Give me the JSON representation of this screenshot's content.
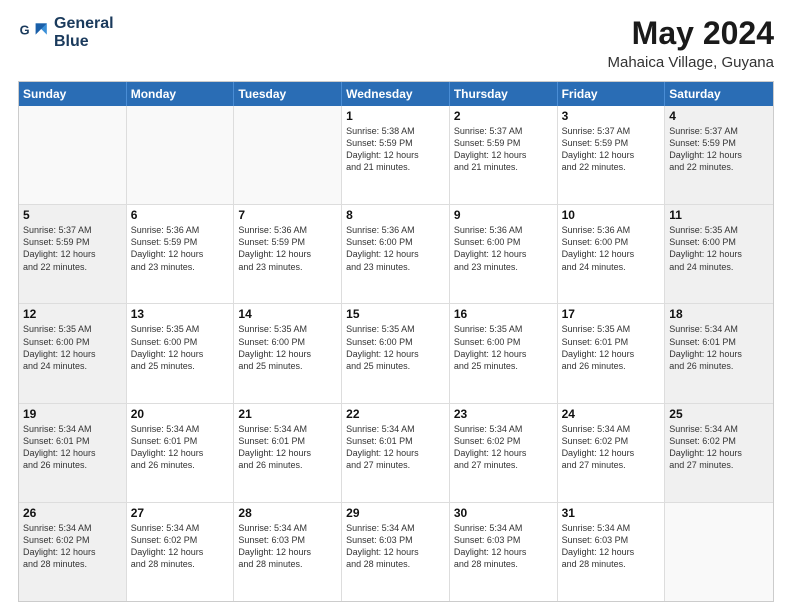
{
  "header": {
    "logo_line1": "General",
    "logo_line2": "Blue",
    "month_title": "May 2024",
    "location": "Mahaica Village, Guyana"
  },
  "days_of_week": [
    "Sunday",
    "Monday",
    "Tuesday",
    "Wednesday",
    "Thursday",
    "Friday",
    "Saturday"
  ],
  "weeks": [
    [
      {
        "day": "",
        "info": ""
      },
      {
        "day": "",
        "info": ""
      },
      {
        "day": "",
        "info": ""
      },
      {
        "day": "1",
        "info": "Sunrise: 5:38 AM\nSunset: 5:59 PM\nDaylight: 12 hours\nand 21 minutes."
      },
      {
        "day": "2",
        "info": "Sunrise: 5:37 AM\nSunset: 5:59 PM\nDaylight: 12 hours\nand 21 minutes."
      },
      {
        "day": "3",
        "info": "Sunrise: 5:37 AM\nSunset: 5:59 PM\nDaylight: 12 hours\nand 22 minutes."
      },
      {
        "day": "4",
        "info": "Sunrise: 5:37 AM\nSunset: 5:59 PM\nDaylight: 12 hours\nand 22 minutes."
      }
    ],
    [
      {
        "day": "5",
        "info": "Sunrise: 5:37 AM\nSunset: 5:59 PM\nDaylight: 12 hours\nand 22 minutes."
      },
      {
        "day": "6",
        "info": "Sunrise: 5:36 AM\nSunset: 5:59 PM\nDaylight: 12 hours\nand 23 minutes."
      },
      {
        "day": "7",
        "info": "Sunrise: 5:36 AM\nSunset: 5:59 PM\nDaylight: 12 hours\nand 23 minutes."
      },
      {
        "day": "8",
        "info": "Sunrise: 5:36 AM\nSunset: 6:00 PM\nDaylight: 12 hours\nand 23 minutes."
      },
      {
        "day": "9",
        "info": "Sunrise: 5:36 AM\nSunset: 6:00 PM\nDaylight: 12 hours\nand 23 minutes."
      },
      {
        "day": "10",
        "info": "Sunrise: 5:36 AM\nSunset: 6:00 PM\nDaylight: 12 hours\nand 24 minutes."
      },
      {
        "day": "11",
        "info": "Sunrise: 5:35 AM\nSunset: 6:00 PM\nDaylight: 12 hours\nand 24 minutes."
      }
    ],
    [
      {
        "day": "12",
        "info": "Sunrise: 5:35 AM\nSunset: 6:00 PM\nDaylight: 12 hours\nand 24 minutes."
      },
      {
        "day": "13",
        "info": "Sunrise: 5:35 AM\nSunset: 6:00 PM\nDaylight: 12 hours\nand 25 minutes."
      },
      {
        "day": "14",
        "info": "Sunrise: 5:35 AM\nSunset: 6:00 PM\nDaylight: 12 hours\nand 25 minutes."
      },
      {
        "day": "15",
        "info": "Sunrise: 5:35 AM\nSunset: 6:00 PM\nDaylight: 12 hours\nand 25 minutes."
      },
      {
        "day": "16",
        "info": "Sunrise: 5:35 AM\nSunset: 6:00 PM\nDaylight: 12 hours\nand 25 minutes."
      },
      {
        "day": "17",
        "info": "Sunrise: 5:35 AM\nSunset: 6:01 PM\nDaylight: 12 hours\nand 26 minutes."
      },
      {
        "day": "18",
        "info": "Sunrise: 5:34 AM\nSunset: 6:01 PM\nDaylight: 12 hours\nand 26 minutes."
      }
    ],
    [
      {
        "day": "19",
        "info": "Sunrise: 5:34 AM\nSunset: 6:01 PM\nDaylight: 12 hours\nand 26 minutes."
      },
      {
        "day": "20",
        "info": "Sunrise: 5:34 AM\nSunset: 6:01 PM\nDaylight: 12 hours\nand 26 minutes."
      },
      {
        "day": "21",
        "info": "Sunrise: 5:34 AM\nSunset: 6:01 PM\nDaylight: 12 hours\nand 26 minutes."
      },
      {
        "day": "22",
        "info": "Sunrise: 5:34 AM\nSunset: 6:01 PM\nDaylight: 12 hours\nand 27 minutes."
      },
      {
        "day": "23",
        "info": "Sunrise: 5:34 AM\nSunset: 6:02 PM\nDaylight: 12 hours\nand 27 minutes."
      },
      {
        "day": "24",
        "info": "Sunrise: 5:34 AM\nSunset: 6:02 PM\nDaylight: 12 hours\nand 27 minutes."
      },
      {
        "day": "25",
        "info": "Sunrise: 5:34 AM\nSunset: 6:02 PM\nDaylight: 12 hours\nand 27 minutes."
      }
    ],
    [
      {
        "day": "26",
        "info": "Sunrise: 5:34 AM\nSunset: 6:02 PM\nDaylight: 12 hours\nand 28 minutes."
      },
      {
        "day": "27",
        "info": "Sunrise: 5:34 AM\nSunset: 6:02 PM\nDaylight: 12 hours\nand 28 minutes."
      },
      {
        "day": "28",
        "info": "Sunrise: 5:34 AM\nSunset: 6:03 PM\nDaylight: 12 hours\nand 28 minutes."
      },
      {
        "day": "29",
        "info": "Sunrise: 5:34 AM\nSunset: 6:03 PM\nDaylight: 12 hours\nand 28 minutes."
      },
      {
        "day": "30",
        "info": "Sunrise: 5:34 AM\nSunset: 6:03 PM\nDaylight: 12 hours\nand 28 minutes."
      },
      {
        "day": "31",
        "info": "Sunrise: 5:34 AM\nSunset: 6:03 PM\nDaylight: 12 hours\nand 28 minutes."
      },
      {
        "day": "",
        "info": ""
      }
    ]
  ]
}
